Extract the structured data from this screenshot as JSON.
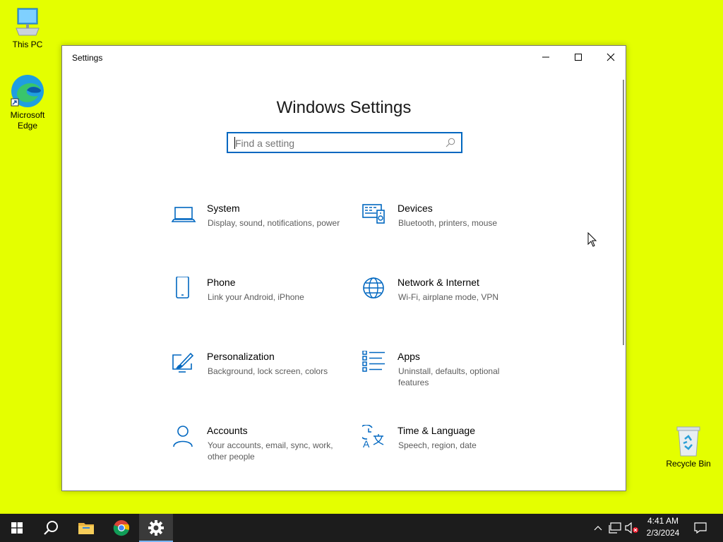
{
  "desktop": {
    "icons": [
      {
        "label": "This PC"
      },
      {
        "label": "Microsoft Edge"
      },
      {
        "label": "Recycle Bin"
      }
    ]
  },
  "window": {
    "title": "Settings",
    "heading": "Windows Settings",
    "search": {
      "placeholder": "Find a setting",
      "value": ""
    },
    "tiles": [
      {
        "name": "System",
        "desc": "Display, sound, notifications, power",
        "icon": "laptop-icon"
      },
      {
        "name": "Devices",
        "desc": "Bluetooth, printers, mouse",
        "icon": "devices-icon"
      },
      {
        "name": "Phone",
        "desc": "Link your Android, iPhone",
        "icon": "phone-icon"
      },
      {
        "name": "Network & Internet",
        "desc": "Wi-Fi, airplane mode, VPN",
        "icon": "globe-icon"
      },
      {
        "name": "Personalization",
        "desc": "Background, lock screen, colors",
        "icon": "paint-icon"
      },
      {
        "name": "Apps",
        "desc": "Uninstall, defaults, optional features",
        "icon": "apps-list-icon"
      },
      {
        "name": "Accounts",
        "desc": "Your accounts, email, sync, work, other people",
        "icon": "person-icon"
      },
      {
        "name": "Time & Language",
        "desc": "Speech, region, date",
        "icon": "time-language-icon"
      }
    ]
  },
  "taskbar": {
    "items": [
      "start-icon",
      "search-icon",
      "file-explorer-icon",
      "chrome-icon",
      "settings-gear-icon"
    ],
    "clock": {
      "time": "4:41 AM",
      "date": "2/3/2024"
    }
  },
  "colors": {
    "desktop": "#e4ff00",
    "accent": "#0067c0",
    "taskbar": "#1c1c1c"
  }
}
